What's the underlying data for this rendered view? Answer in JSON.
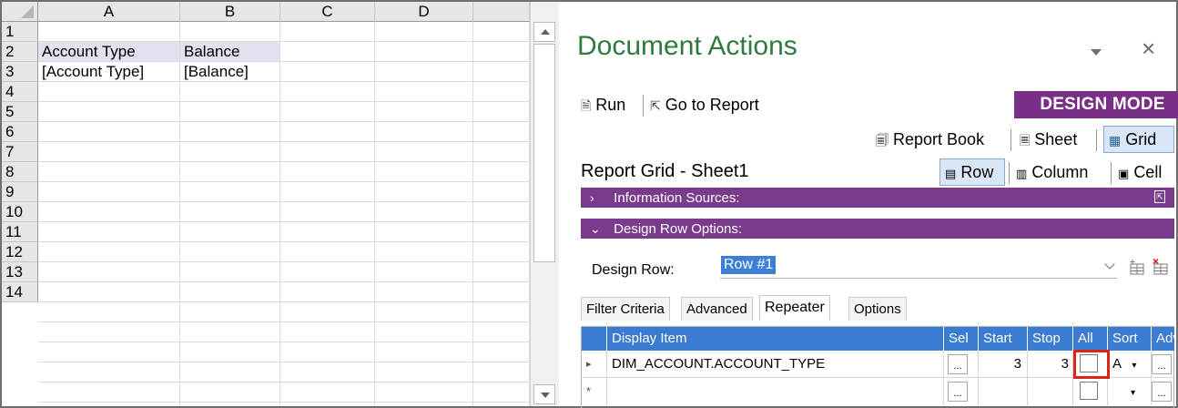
{
  "sheet": {
    "columns": [
      "A",
      "B",
      "C",
      "D"
    ],
    "rows": [
      "1",
      "2",
      "3",
      "4",
      "5",
      "6",
      "7",
      "8",
      "9",
      "10",
      "11",
      "12",
      "13",
      "14"
    ],
    "cells": {
      "A2": "Account Type",
      "B2": "Balance",
      "A3": "[Account Type]",
      "B3": "[Balance]"
    }
  },
  "pane": {
    "title": "Document Actions",
    "close_glyph": "×",
    "toolbar": {
      "run": "Run",
      "go_to_report": "Go to Report",
      "design_mode": "DESIGN MODE"
    },
    "views": {
      "report_book": "Report Book",
      "sheet": "Sheet",
      "grid": "Grid"
    },
    "report_grid_title": "Report Grid - Sheet1",
    "segments": {
      "row": "Row",
      "column": "Column",
      "cell": "Cell"
    },
    "sections": {
      "information_sources": "Information Sources:",
      "design_row_options": "Design Row Options:"
    },
    "design_row": {
      "label": "Design Row:",
      "value": "Row #1"
    },
    "tabs": [
      "Filter Criteria",
      "Advanced",
      "Repeater",
      "Options"
    ],
    "active_tab": "Repeater",
    "grid": {
      "headers": [
        "Display Item",
        "Sel",
        "Start",
        "Stop",
        "All",
        "Sort",
        "Adv"
      ],
      "rows": [
        {
          "marker": "▸",
          "display_item": "DIM_ACCOUNT.ACCOUNT_TYPE",
          "sel": "...",
          "start": "3",
          "stop": "3",
          "all": false,
          "sort": "A",
          "adv": "..."
        },
        {
          "marker": "*",
          "display_item": "",
          "sel": "...",
          "start": "",
          "stop": "",
          "all": false,
          "sort": "",
          "adv": "..."
        }
      ]
    },
    "colors": {
      "title_green": "#2e7a3f",
      "purple": "#7a3b8c",
      "grid_header_blue": "#3a7cd0",
      "highlight_red": "#e0201b"
    }
  }
}
